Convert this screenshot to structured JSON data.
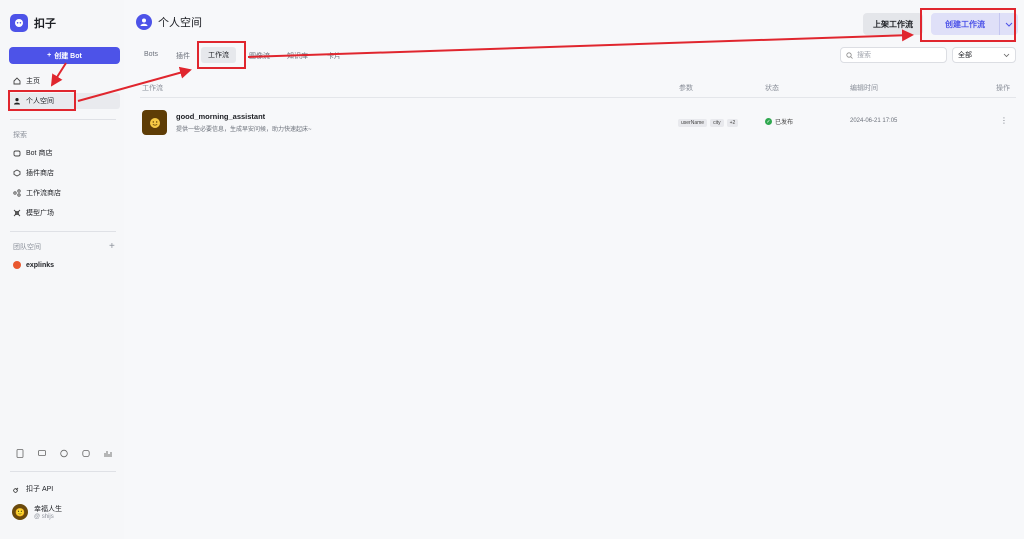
{
  "app": {
    "logo_text": "扣子"
  },
  "sidebar": {
    "create_bot": "创建 Bot",
    "nav": [
      {
        "label": "主页",
        "icon": "home-icon"
      },
      {
        "label": "个人空间",
        "icon": "user-icon",
        "active": true
      }
    ],
    "explore_label": "探索",
    "explore": [
      {
        "label": "Bot 商店",
        "icon": "bot-icon"
      },
      {
        "label": "插件商店",
        "icon": "plugin-icon"
      },
      {
        "label": "工作流商店",
        "icon": "workflow-icon"
      },
      {
        "label": "模型广场",
        "icon": "model-icon"
      }
    ],
    "team_label": "团队空间",
    "team": [
      {
        "label": "explinks",
        "icon": "team-logo-icon"
      }
    ],
    "bottom_icons": [
      "doc-icon",
      "chat-icon",
      "discord-icon",
      "feishu-icon",
      "chart-icon"
    ],
    "api_link": "扣子 API",
    "user": {
      "name": "幸福人生",
      "handle": "@ shijs"
    }
  },
  "header": {
    "title": "个人空间",
    "list_workflow_button": "上架工作流",
    "create_workflow_button": "创建工作流"
  },
  "tabs": [
    "Bots",
    "插件",
    "工作流",
    "图像流",
    "知识库",
    "卡片"
  ],
  "active_tab": "工作流",
  "search": {
    "placeholder": "搜索"
  },
  "filter": {
    "selected": "全部"
  },
  "table": {
    "headers": [
      "工作流",
      "参数",
      "状态",
      "编辑时间",
      "操作"
    ],
    "rows": [
      {
        "name": "good_morning_assistant",
        "description": "提供一些必要信息，生成早安问候，助力快速起床~",
        "params": [
          "userName",
          "city",
          "+2"
        ],
        "status": "已发布",
        "edit_time": "2024-06-21 17:05"
      }
    ]
  },
  "colors": {
    "accent": "#4d53e8",
    "annotation": "#e0262e",
    "published": "#2fa84f"
  }
}
